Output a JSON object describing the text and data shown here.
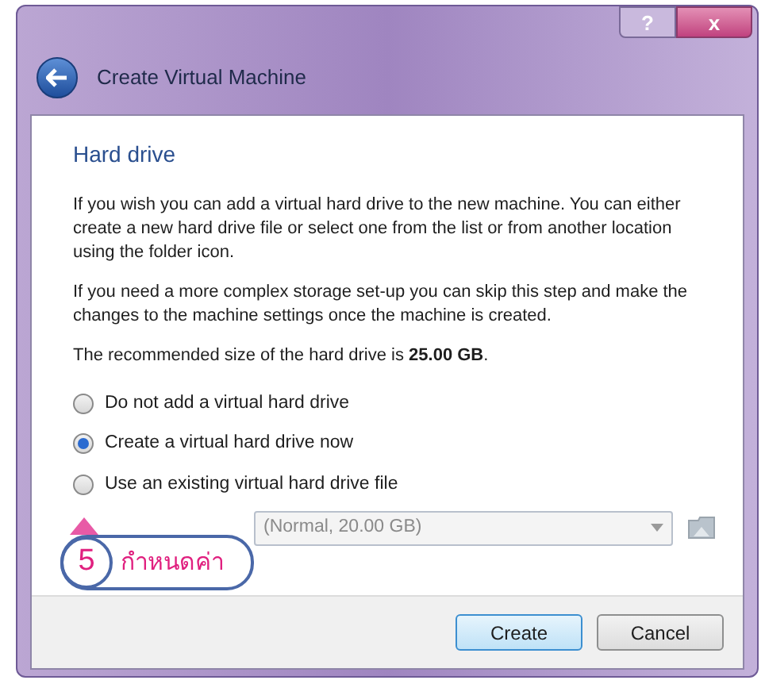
{
  "window": {
    "title": "Create Virtual Machine",
    "help_button": "?",
    "close_button": "x"
  },
  "page": {
    "heading": "Hard drive",
    "paragraphs": [
      "If you wish you can add a virtual hard drive to the new machine. You can either create a new hard drive file or select one from the list or from another location using the folder icon.",
      "If you need a more complex storage set-up you can skip this step and make the changes to the machine settings once the machine is created.",
      "The recommended size of the hard drive is **25.00 GB**."
    ],
    "options": [
      {
        "label": "Do not add a virtual hard drive",
        "selected": false
      },
      {
        "label": "Create a virtual hard drive now",
        "selected": true
      },
      {
        "label": "Use an existing virtual hard drive file",
        "selected": false
      }
    ],
    "file_select": {
      "value": "(Normal, 20.00 GB)",
      "disabled": true
    }
  },
  "callout": {
    "number": "5",
    "label": "กำหนดค่า"
  },
  "buttons": [
    {
      "label": "Create",
      "kind": "default"
    },
    {
      "label": "Cancel",
      "kind": "normal"
    }
  ]
}
